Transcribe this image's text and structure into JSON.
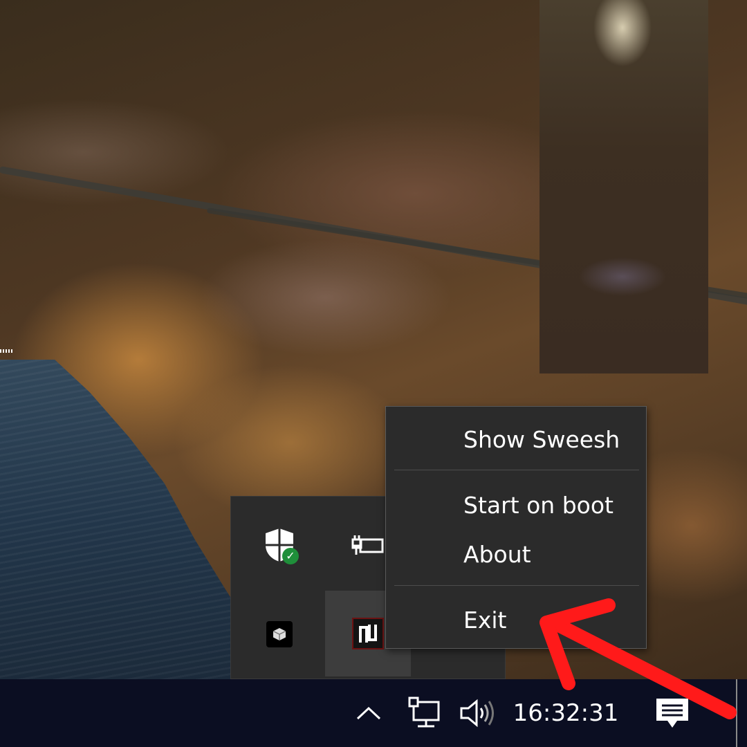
{
  "context_menu": {
    "items": [
      {
        "label": "Show Sweesh"
      },
      {
        "label": "Start on boot"
      },
      {
        "label": "About"
      },
      {
        "label": "Exit"
      }
    ]
  },
  "tray_overflow": {
    "icons": [
      {
        "name": "windows-security-icon"
      },
      {
        "name": "power-plug-icon"
      },
      {
        "name": "app-cube-icon"
      },
      {
        "name": "sweesh-app-icon",
        "hovered": true
      }
    ]
  },
  "taskbar": {
    "clock": "16:32:31",
    "icons": [
      "chevron-up-icon",
      "network-icon",
      "volume-icon",
      "notification-icon"
    ],
    "background": "#0b0e22"
  },
  "annotation": {
    "arrow_color": "#ff1a1a",
    "points_to": "Exit"
  },
  "colors": {
    "menu_bg": "#2b2b2b",
    "menu_text": "#ffffff",
    "sweesh_accent": "#6b1212",
    "security_badge": "#1f8f3a"
  }
}
